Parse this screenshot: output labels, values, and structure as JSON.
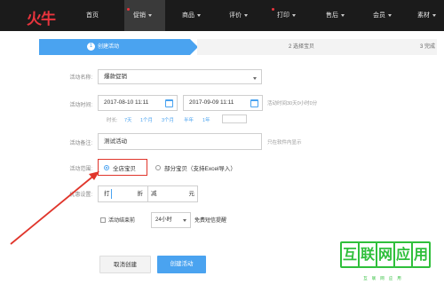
{
  "nav": {
    "logo": "火牛",
    "items": [
      {
        "label": "首页",
        "caret": false,
        "dot": false,
        "active": false
      },
      {
        "label": "促销",
        "caret": true,
        "dot": true,
        "active": true
      },
      {
        "label": "商品",
        "caret": true,
        "dot": false,
        "active": false
      },
      {
        "label": "评价",
        "caret": true,
        "dot": false,
        "active": false
      },
      {
        "label": "打印",
        "caret": true,
        "dot": true,
        "active": false
      },
      {
        "label": "售后",
        "caret": true,
        "dot": false,
        "active": false
      },
      {
        "label": "会员",
        "caret": true,
        "dot": false,
        "active": false
      },
      {
        "label": "素材",
        "caret": true,
        "dot": false,
        "active": false
      }
    ]
  },
  "steps": [
    {
      "num": "1",
      "label": "创建活动"
    },
    {
      "num": "2",
      "label": "选择宝贝"
    },
    {
      "num": "3",
      "label": "完成"
    }
  ],
  "form": {
    "name_label": "活动名称:",
    "name_value": "爆款促销",
    "time_label": "活动时间:",
    "start_time": "2017-08-10 11:11",
    "end_time": "2017-09-09 11:11",
    "time_hint": "活动时间30天0小时0分",
    "quick_label": "时长:",
    "quick_options": [
      "7天",
      "1个月",
      "3个月",
      "半年",
      "1年"
    ],
    "remark_label": "活动备注:",
    "remark_value": "测试活动",
    "remark_hint": "只在软件内显示",
    "scope_label": "活动范围:",
    "scope_all": "全店宝贝",
    "scope_part": "部分宝贝（支持Excel导入）",
    "discount_label": "优惠设置:",
    "discount_left": "打",
    "discount_unit": "折",
    "discount_minus": "减",
    "discount_yuan": "元",
    "remind_label": "活动结束前",
    "remind_value": "24小时",
    "remind_hint": "免费短信提醒"
  },
  "buttons": {
    "cancel": "取消创建",
    "create": "创建活动"
  },
  "watermark": {
    "chars": [
      "互",
      "联",
      "网",
      "应",
      "用"
    ],
    "sub": "互联网应用"
  },
  "colors": {
    "accent": "#4aa3f0",
    "nav_bg": "#1b1b1b",
    "highlight": "#e0352b",
    "watermark": "#2fbf3b"
  }
}
